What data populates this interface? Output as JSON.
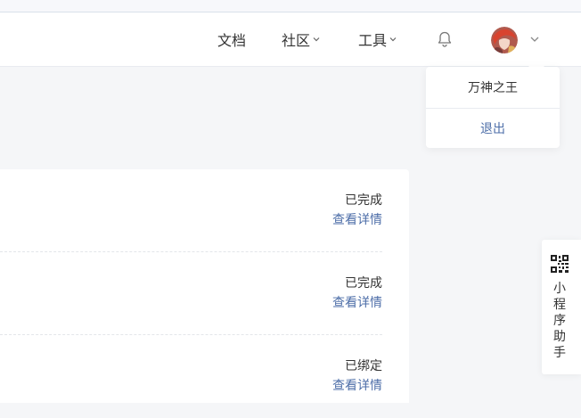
{
  "header": {
    "nav": {
      "docs": "文档",
      "community": "社区",
      "tools": "工具"
    },
    "icons": {
      "bell": "bell-icon",
      "chevron": "chevron-down-icon"
    }
  },
  "user_menu": {
    "username": "万神之王",
    "logout": "退出"
  },
  "list": {
    "rows": [
      {
        "status": "已完成",
        "action": "查看详情"
      },
      {
        "status": "已完成",
        "action": "查看详情"
      },
      {
        "status": "已绑定",
        "action": "查看详情"
      }
    ]
  },
  "side_float": {
    "label": "小程序助手",
    "icon": "qr-code-icon"
  },
  "colors": {
    "link": "#4d6ea8",
    "text": "#333333",
    "background": "#f5f6f8"
  }
}
